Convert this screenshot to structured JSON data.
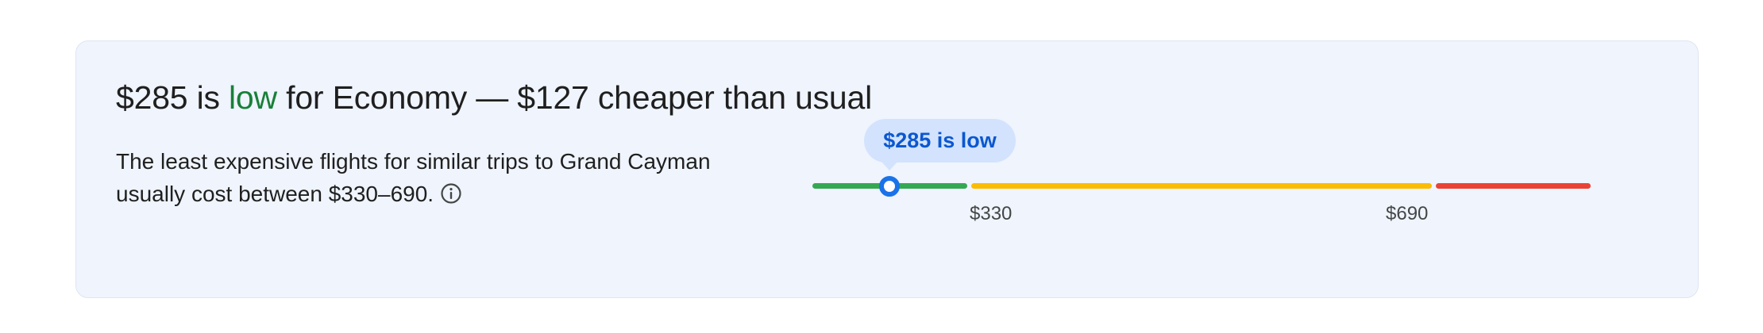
{
  "headline": {
    "price": "$285",
    "is_text": " is ",
    "level": "low",
    "rest": " for Economy — $127 cheaper than usual"
  },
  "description": {
    "text": "The least expensive flights for similar trips to Grand Cayman usually cost between $330–690."
  },
  "price_meter": {
    "bubble_label": "$285 is low",
    "current_price": 285,
    "typical_low": 330,
    "typical_high": 690,
    "low_label": "$330",
    "high_label": "$690",
    "colors": {
      "low": "#34a853",
      "typical": "#fbbc04",
      "high": "#ea4335",
      "marker": "#1a73e8",
      "bubble_bg": "#d3e3fd",
      "bubble_text": "#0b57d0",
      "level_text": "#188038"
    }
  },
  "icons": {
    "info": "info-icon"
  }
}
